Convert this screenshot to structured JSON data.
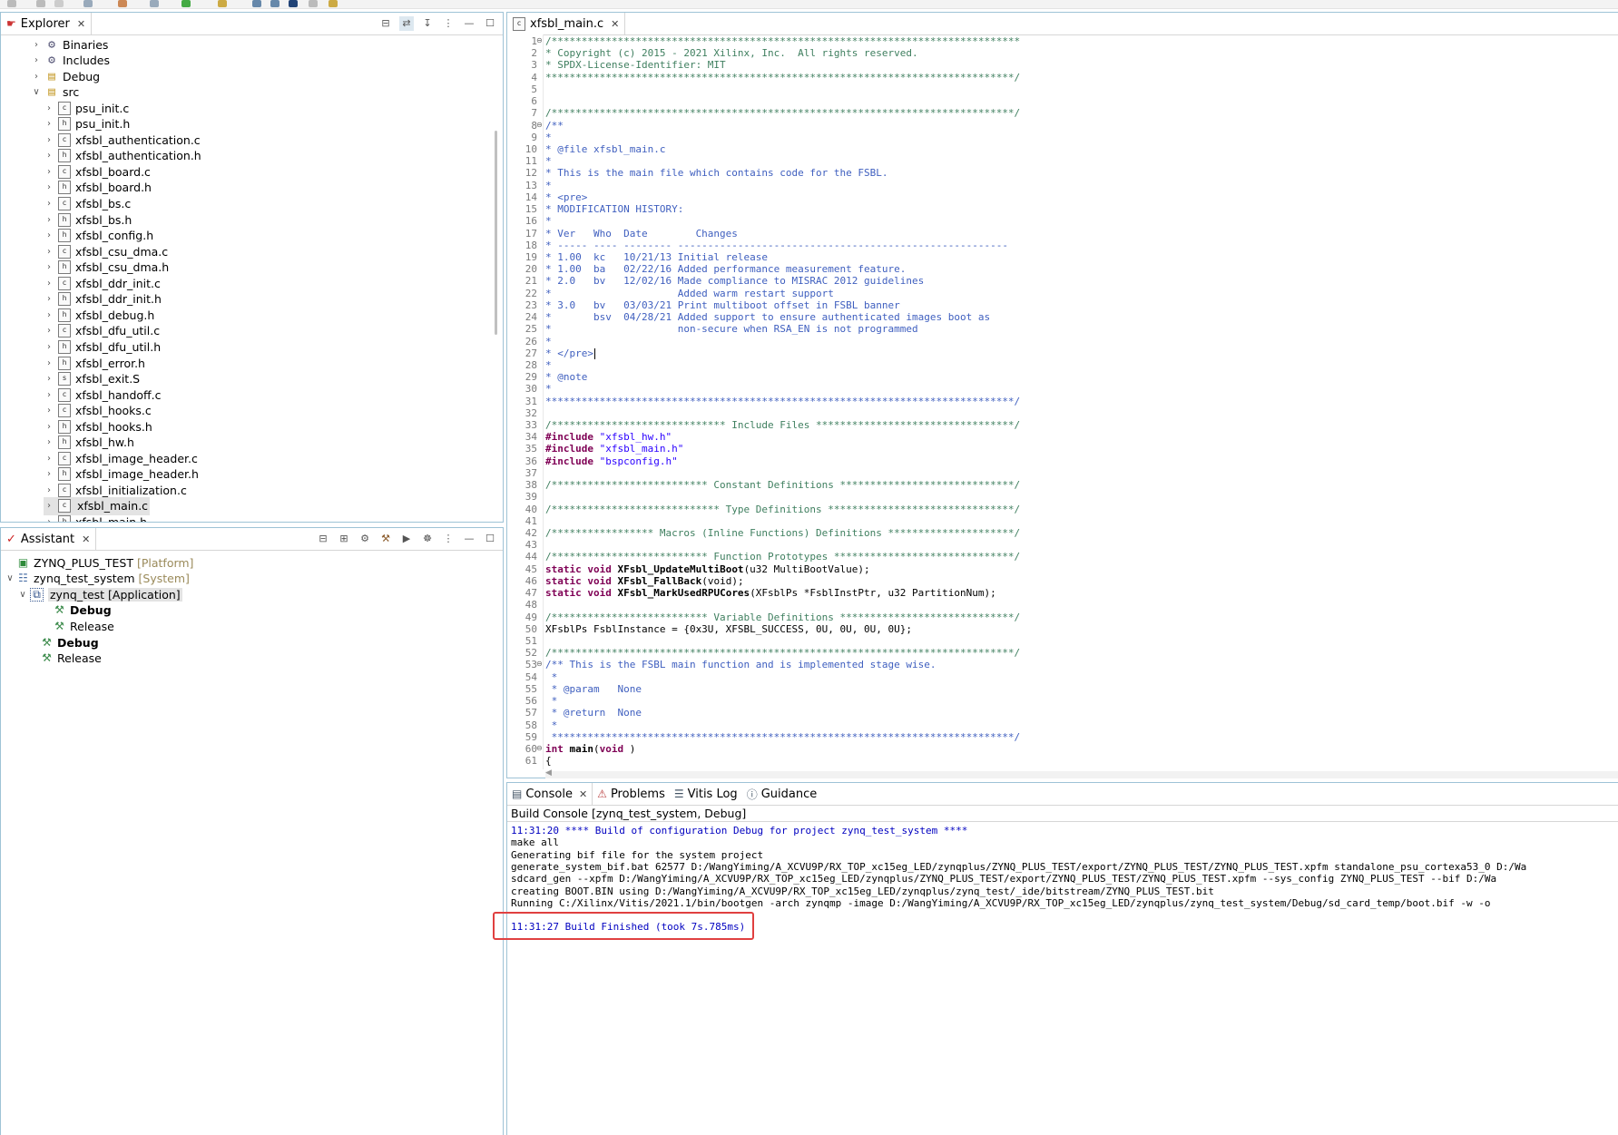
{
  "colors": {
    "panel_border": "#9ec3d6",
    "comment": "#3f7f5f",
    "doc_comment": "#3f5fbf",
    "keyword": "#7f0055",
    "string": "#2a00ff",
    "console_blue": "#0000c0",
    "highlight_box": "#e04040"
  },
  "explorer": {
    "tab_label": "Explorer",
    "items": [
      {
        "label": "Binaries",
        "icon": "binaries-icon",
        "kind": "folder-special",
        "depth": 1,
        "expanded": false
      },
      {
        "label": "Includes",
        "icon": "includes-icon",
        "kind": "folder-special",
        "depth": 1,
        "expanded": false
      },
      {
        "label": "Debug",
        "icon": "folder-icon",
        "kind": "folder",
        "depth": 1,
        "expanded": false
      },
      {
        "label": "src",
        "icon": "folder-open-icon",
        "kind": "folder",
        "depth": 1,
        "expanded": true
      },
      {
        "label": "psu_init.c",
        "icon": "c-file-icon",
        "kind": "c",
        "depth": 2
      },
      {
        "label": "psu_init.h",
        "icon": "h-file-icon",
        "kind": "h",
        "depth": 2
      },
      {
        "label": "xfsbl_authentication.c",
        "icon": "c-file-icon",
        "kind": "c",
        "depth": 2
      },
      {
        "label": "xfsbl_authentication.h",
        "icon": "h-file-icon",
        "kind": "h",
        "depth": 2
      },
      {
        "label": "xfsbl_board.c",
        "icon": "c-file-icon",
        "kind": "c",
        "depth": 2
      },
      {
        "label": "xfsbl_board.h",
        "icon": "h-file-icon",
        "kind": "h",
        "depth": 2
      },
      {
        "label": "xfsbl_bs.c",
        "icon": "c-file-icon",
        "kind": "c",
        "depth": 2
      },
      {
        "label": "xfsbl_bs.h",
        "icon": "h-file-icon",
        "kind": "h",
        "depth": 2
      },
      {
        "label": "xfsbl_config.h",
        "icon": "h-file-icon",
        "kind": "h",
        "depth": 2
      },
      {
        "label": "xfsbl_csu_dma.c",
        "icon": "c-file-icon",
        "kind": "c",
        "depth": 2
      },
      {
        "label": "xfsbl_csu_dma.h",
        "icon": "h-file-icon",
        "kind": "h",
        "depth": 2
      },
      {
        "label": "xfsbl_ddr_init.c",
        "icon": "c-file-icon",
        "kind": "c",
        "depth": 2
      },
      {
        "label": "xfsbl_ddr_init.h",
        "icon": "h-file-icon",
        "kind": "h",
        "depth": 2
      },
      {
        "label": "xfsbl_debug.h",
        "icon": "h-file-icon",
        "kind": "h",
        "depth": 2
      },
      {
        "label": "xfsbl_dfu_util.c",
        "icon": "c-file-icon",
        "kind": "c",
        "depth": 2
      },
      {
        "label": "xfsbl_dfu_util.h",
        "icon": "h-file-icon",
        "kind": "h",
        "depth": 2
      },
      {
        "label": "xfsbl_error.h",
        "icon": "h-file-icon",
        "kind": "h",
        "depth": 2
      },
      {
        "label": "xfsbl_exit.S",
        "icon": "s-file-icon",
        "kind": "s",
        "depth": 2
      },
      {
        "label": "xfsbl_handoff.c",
        "icon": "c-file-icon",
        "kind": "c",
        "depth": 2
      },
      {
        "label": "xfsbl_hooks.c",
        "icon": "c-file-icon",
        "kind": "c",
        "depth": 2
      },
      {
        "label": "xfsbl_hooks.h",
        "icon": "h-file-icon",
        "kind": "h",
        "depth": 2
      },
      {
        "label": "xfsbl_hw.h",
        "icon": "h-file-icon",
        "kind": "h",
        "depth": 2
      },
      {
        "label": "xfsbl_image_header.c",
        "icon": "c-file-icon",
        "kind": "c",
        "depth": 2
      },
      {
        "label": "xfsbl_image_header.h",
        "icon": "h-file-icon",
        "kind": "h",
        "depth": 2
      },
      {
        "label": "xfsbl_initialization.c",
        "icon": "c-file-icon",
        "kind": "c",
        "depth": 2
      },
      {
        "label": "xfsbl_main.c",
        "icon": "c-file-icon",
        "kind": "c",
        "depth": 2,
        "selected": true
      },
      {
        "label": "xfsbl_main.h",
        "icon": "h-file-icon",
        "kind": "h",
        "depth": 2
      }
    ]
  },
  "assistant": {
    "tab_label": "Assistant",
    "items": [
      {
        "label": "ZYNQ_PLUS_TEST",
        "tag": "[Platform]",
        "icon": "platform-icon",
        "indent": 0,
        "chev": "",
        "bold": false
      },
      {
        "label": "zynq_test_system",
        "tag": "[System]",
        "icon": "system-icon",
        "indent": 0,
        "chev": "v",
        "bold": false
      },
      {
        "label": "zynq_test [Application]",
        "tag": "",
        "icon": "application-icon",
        "indent": 1,
        "chev": "v",
        "bold": false,
        "selected": true
      },
      {
        "label": "Debug",
        "tag": "",
        "icon": "build-config-icon",
        "indent": 2,
        "chev": "",
        "bold": true
      },
      {
        "label": "Release",
        "tag": "",
        "icon": "build-config-icon",
        "indent": 2,
        "chev": "",
        "bold": false
      },
      {
        "label": "Debug",
        "tag": "",
        "icon": "build-config-icon",
        "indent": 1,
        "chev": "",
        "bold": true
      },
      {
        "label": "Release",
        "tag": "",
        "icon": "build-config-icon",
        "indent": 1,
        "chev": "",
        "bold": false
      }
    ]
  },
  "editor": {
    "tab_label": "xfsbl_main.c",
    "lines": [
      {
        "n": "1",
        "fold": true,
        "parts": [
          {
            "t": "/******************************************************************************",
            "c": "comment"
          }
        ]
      },
      {
        "n": "2",
        "parts": [
          {
            "t": "* Copyright (c) 2015 - 2021 Xilinx, Inc.  All rights reserved.",
            "c": "comment"
          }
        ]
      },
      {
        "n": "3",
        "parts": [
          {
            "t": "* SPDX-License-Identifier: MIT",
            "c": "comment"
          }
        ]
      },
      {
        "n": "4",
        "parts": [
          {
            "t": "******************************************************************************/",
            "c": "comment"
          }
        ]
      },
      {
        "n": "5",
        "parts": []
      },
      {
        "n": "6",
        "parts": []
      },
      {
        "n": "7",
        "parts": [
          {
            "t": "/*****************************************************************************/",
            "c": "comment"
          }
        ]
      },
      {
        "n": "8",
        "fold": true,
        "parts": [
          {
            "t": "/**",
            "c": "doc"
          }
        ]
      },
      {
        "n": "9",
        "parts": [
          {
            "t": "*",
            "c": "doc"
          }
        ]
      },
      {
        "n": "10",
        "parts": [
          {
            "t": "* @file xfsbl_main.c",
            "c": "doc"
          }
        ]
      },
      {
        "n": "11",
        "parts": [
          {
            "t": "*",
            "c": "doc"
          }
        ]
      },
      {
        "n": "12",
        "parts": [
          {
            "t": "* This is the main file which contains code for the FSBL.",
            "c": "doc"
          }
        ]
      },
      {
        "n": "13",
        "parts": [
          {
            "t": "*",
            "c": "doc"
          }
        ]
      },
      {
        "n": "14",
        "parts": [
          {
            "t": "* <pre>",
            "c": "doc"
          }
        ]
      },
      {
        "n": "15",
        "parts": [
          {
            "t": "* MODIFICATION HISTORY:",
            "c": "doc"
          }
        ]
      },
      {
        "n": "16",
        "parts": [
          {
            "t": "*",
            "c": "doc"
          }
        ]
      },
      {
        "n": "17",
        "parts": [
          {
            "t": "* Ver   Who  Date        Changes",
            "c": "doc"
          }
        ]
      },
      {
        "n": "18",
        "parts": [
          {
            "t": "* ----- ---- -------- -------------------------------------------------------",
            "c": "doc"
          }
        ]
      },
      {
        "n": "19",
        "parts": [
          {
            "t": "* 1.00  kc   10/21/13 Initial release",
            "c": "doc"
          }
        ]
      },
      {
        "n": "20",
        "parts": [
          {
            "t": "* 1.00  ba   02/22/16 Added performance measurement feature.",
            "c": "doc"
          }
        ]
      },
      {
        "n": "21",
        "parts": [
          {
            "t": "* 2.0   bv   12/02/16 Made compliance to MISRAC 2012 guidelines",
            "c": "doc"
          }
        ]
      },
      {
        "n": "22",
        "parts": [
          {
            "t": "*                     Added warm restart support",
            "c": "doc"
          }
        ]
      },
      {
        "n": "23",
        "parts": [
          {
            "t": "* 3.0   bv   03/03/21 Print multiboot offset in FSBL banner",
            "c": "doc"
          }
        ]
      },
      {
        "n": "24",
        "parts": [
          {
            "t": "*       bsv  04/28/21 Added support to ensure authenticated images boot as",
            "c": "doc"
          }
        ]
      },
      {
        "n": "25",
        "parts": [
          {
            "t": "*                     non-secure when RSA_EN is not programmed",
            "c": "doc"
          }
        ]
      },
      {
        "n": "26",
        "parts": [
          {
            "t": "*",
            "c": "doc"
          }
        ]
      },
      {
        "n": "27",
        "parts": [
          {
            "t": "* </pre>",
            "c": "doc"
          }
        ]
      },
      {
        "n": "28",
        "parts": [
          {
            "t": "*",
            "c": "doc"
          }
        ]
      },
      {
        "n": "29",
        "parts": [
          {
            "t": "* @note",
            "c": "doc"
          }
        ]
      },
      {
        "n": "30",
        "parts": [
          {
            "t": "*",
            "c": "doc"
          }
        ]
      },
      {
        "n": "31",
        "parts": [
          {
            "t": "******************************************************************************/",
            "c": "doc"
          }
        ]
      },
      {
        "n": "32",
        "parts": []
      },
      {
        "n": "33",
        "parts": [
          {
            "t": "/***************************** Include Files *********************************/",
            "c": "comment"
          }
        ]
      },
      {
        "n": "34",
        "parts": [
          {
            "t": "#include ",
            "c": "kw"
          },
          {
            "t": "\"xfsbl_hw.h\"",
            "c": "str"
          }
        ]
      },
      {
        "n": "35",
        "parts": [
          {
            "t": "#include ",
            "c": "kw"
          },
          {
            "t": "\"xfsbl_main.h\"",
            "c": "str"
          }
        ]
      },
      {
        "n": "36",
        "parts": [
          {
            "t": "#include ",
            "c": "kw"
          },
          {
            "t": "\"bspconfig.h\"",
            "c": "str"
          }
        ]
      },
      {
        "n": "37",
        "parts": []
      },
      {
        "n": "38",
        "parts": [
          {
            "t": "/************************** Constant Definitions *****************************/",
            "c": "comment"
          }
        ]
      },
      {
        "n": "39",
        "parts": []
      },
      {
        "n": "40",
        "parts": [
          {
            "t": "/**************************** Type Definitions *******************************/",
            "c": "comment"
          }
        ]
      },
      {
        "n": "41",
        "parts": []
      },
      {
        "n": "42",
        "parts": [
          {
            "t": "/***************** Macros (Inline Functions) Definitions *********************/",
            "c": "comment"
          }
        ]
      },
      {
        "n": "43",
        "parts": []
      },
      {
        "n": "44",
        "parts": [
          {
            "t": "/************************** Function Prototypes ******************************/",
            "c": "comment"
          }
        ]
      },
      {
        "n": "45",
        "parts": [
          {
            "t": "static void ",
            "c": "kw"
          },
          {
            "t": "XFsbl_UpdateMultiBoot",
            "c": "fn"
          },
          {
            "t": "(u32 MultiBootValue);",
            "c": "plain"
          }
        ]
      },
      {
        "n": "46",
        "parts": [
          {
            "t": "static void ",
            "c": "kw"
          },
          {
            "t": "XFsbl_FallBack",
            "c": "fn"
          },
          {
            "t": "(void);",
            "c": "plain"
          }
        ]
      },
      {
        "n": "47",
        "parts": [
          {
            "t": "static void ",
            "c": "kw"
          },
          {
            "t": "XFsbl_MarkUsedRPUCores",
            "c": "fn"
          },
          {
            "t": "(XFsblPs *FsblInstPtr, u32 PartitionNum);",
            "c": "plain"
          }
        ]
      },
      {
        "n": "48",
        "parts": []
      },
      {
        "n": "49",
        "parts": [
          {
            "t": "/************************** Variable Definitions *****************************/",
            "c": "comment"
          }
        ]
      },
      {
        "n": "50",
        "parts": [
          {
            "t": "XFsblPs FsblInstance = {0x3U, XFSBL_SUCCESS, 0U, 0U, 0U, 0U};",
            "c": "plain"
          }
        ]
      },
      {
        "n": "51",
        "parts": []
      },
      {
        "n": "52",
        "parts": [
          {
            "t": "/*****************************************************************************/",
            "c": "comment"
          }
        ]
      },
      {
        "n": "53",
        "fold": true,
        "parts": [
          {
            "t": "/** This is the FSBL main function and is implemented stage wise.",
            "c": "doc"
          }
        ]
      },
      {
        "n": "54",
        "parts": [
          {
            "t": " *",
            "c": "doc"
          }
        ]
      },
      {
        "n": "55",
        "parts": [
          {
            "t": " * @param   None",
            "c": "doc"
          }
        ]
      },
      {
        "n": "56",
        "parts": [
          {
            "t": " *",
            "c": "doc"
          }
        ]
      },
      {
        "n": "57",
        "parts": [
          {
            "t": " * @return  None",
            "c": "doc"
          }
        ]
      },
      {
        "n": "58",
        "parts": [
          {
            "t": " *",
            "c": "doc"
          }
        ]
      },
      {
        "n": "59",
        "parts": [
          {
            "t": " *****************************************************************************/",
            "c": "doc"
          }
        ]
      },
      {
        "n": "60",
        "fold": true,
        "parts": [
          {
            "t": "int ",
            "c": "kw"
          },
          {
            "t": "main",
            "c": "fn"
          },
          {
            "t": "(",
            "c": "plain"
          },
          {
            "t": "void",
            "c": "kw"
          },
          {
            "t": " )",
            "c": "plain"
          }
        ]
      },
      {
        "n": "61",
        "parts": [
          {
            "t": "{",
            "c": "plain"
          }
        ]
      }
    ]
  },
  "console": {
    "tabs": [
      {
        "label": "Console",
        "icon": "console-icon",
        "active": true
      },
      {
        "label": "Problems",
        "icon": "problems-icon"
      },
      {
        "label": "Vitis Log",
        "icon": "vitis-log-icon"
      },
      {
        "label": "Guidance",
        "icon": "info-icon"
      }
    ],
    "title": "Build Console [zynq_test_system, Debug]",
    "lines": [
      {
        "t": "11:31:20 **** Build of configuration Debug for project zynq_test_system ****",
        "c": "blue"
      },
      {
        "t": "make all",
        "c": "black"
      },
      {
        "t": "Generating bif file for the system project",
        "c": "black"
      },
      {
        "t": "generate_system_bif.bat 62577 D:/WangYiming/A_XCVU9P/RX_TOP_xc15eg_LED/zynqplus/ZYNQ_PLUS_TEST/export/ZYNQ_PLUS_TEST/ZYNQ_PLUS_TEST.xpfm standalone_psu_cortexa53_0 D:/Wa",
        "c": "black"
      },
      {
        "t": "sdcard_gen --xpfm D:/WangYiming/A_XCVU9P/RX_TOP_xc15eg_LED/zynqplus/ZYNQ_PLUS_TEST/export/ZYNQ_PLUS_TEST/ZYNQ_PLUS_TEST.xpfm --sys_config ZYNQ_PLUS_TEST --bif D:/Wa",
        "c": "black"
      },
      {
        "t": "creating BOOT.BIN using D:/WangYiming/A_XCVU9P/RX_TOP_xc15eg_LED/zynqplus/zynq_test/_ide/bitstream/ZYNQ_PLUS_TEST.bit",
        "c": "black"
      },
      {
        "t": "Running C:/Xilinx/Vitis/2021.1/bin/bootgen -arch zynqmp -image D:/WangYiming/A_XCVU9P/RX_TOP_xc15eg_LED/zynqplus/zynq_test_system/Debug/sd_card_temp/boot.bif -w -o",
        "c": "black"
      },
      {
        "t": "",
        "c": "black"
      },
      {
        "t": "11:31:27 Build Finished (took 7s.785ms)",
        "c": "blue"
      }
    ]
  }
}
